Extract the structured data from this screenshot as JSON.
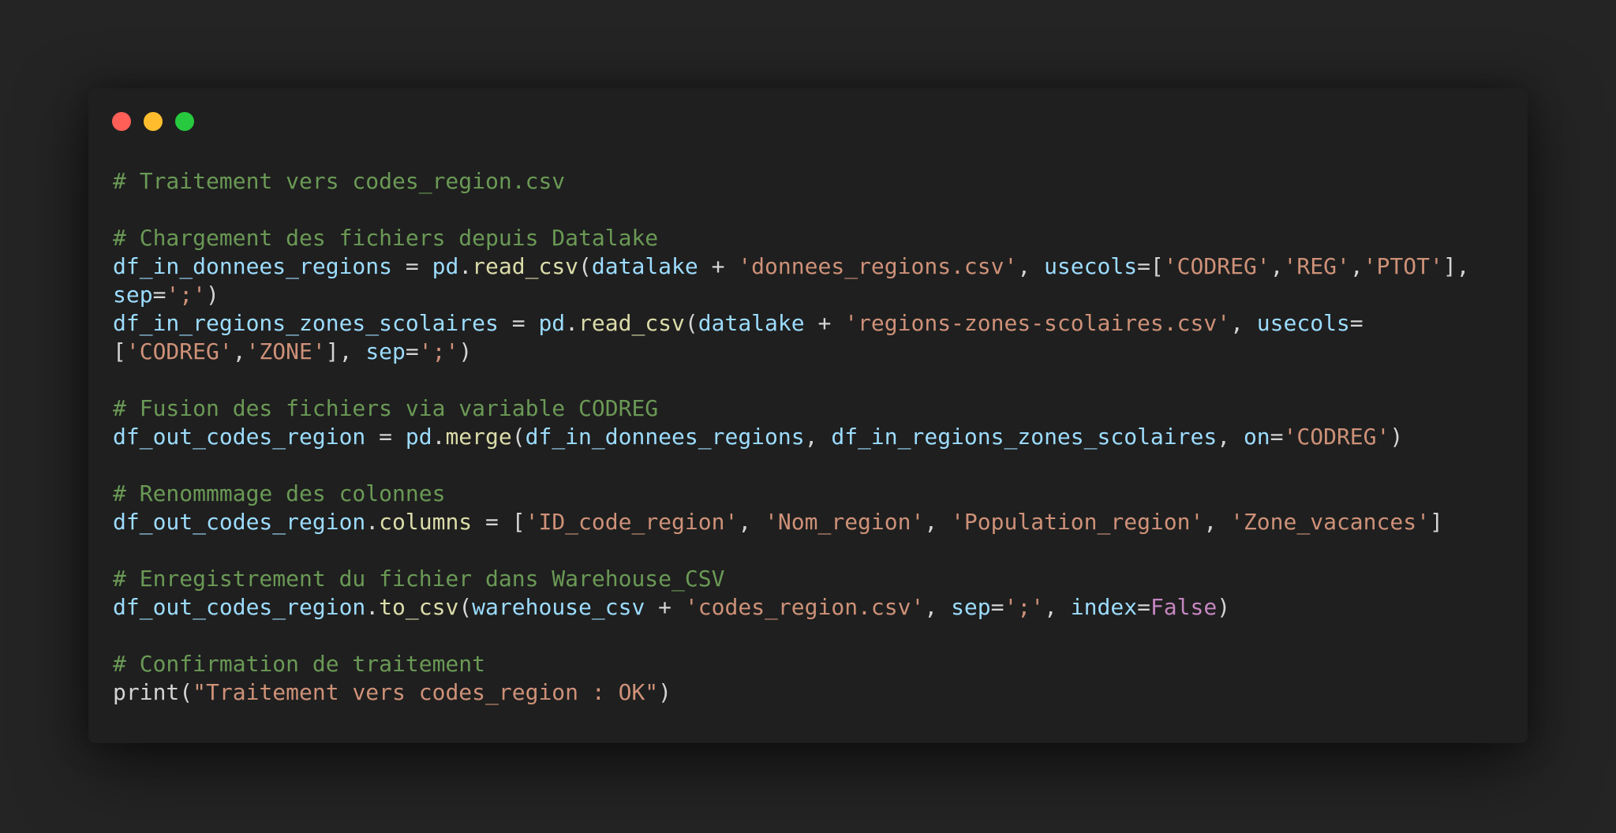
{
  "colors": {
    "background": "#242424",
    "window": "#1f1f1f",
    "dot_close": "#ff5f56",
    "dot_minimize": "#ffbd2e",
    "dot_maximize": "#27c93f",
    "comment": "#6a9955",
    "variable": "#9cdcfe",
    "function": "#dcdcaa",
    "string": "#ce9178",
    "keyword": "#c586c0",
    "plain": "#d4d4d4"
  },
  "window_controls": [
    {
      "name": "close-dot"
    },
    {
      "name": "minimize-dot"
    },
    {
      "name": "maximize-dot"
    }
  ],
  "code_lines": [
    [
      {
        "t": "comment",
        "v": "# Traitement vers codes_region.csv"
      }
    ],
    [],
    [
      {
        "t": "comment",
        "v": "# Chargement des fichiers depuis Datalake"
      }
    ],
    [
      {
        "t": "var",
        "v": "df_in_donnees_regions"
      },
      {
        "t": "plain",
        "v": " = "
      },
      {
        "t": "var",
        "v": "pd"
      },
      {
        "t": "plain",
        "v": "."
      },
      {
        "t": "func",
        "v": "read_csv"
      },
      {
        "t": "plain",
        "v": "("
      },
      {
        "t": "var",
        "v": "datalake"
      },
      {
        "t": "plain",
        "v": " + "
      },
      {
        "t": "string",
        "v": "'donnees_regions.csv'"
      },
      {
        "t": "plain",
        "v": ", "
      },
      {
        "t": "var",
        "v": "usecols"
      },
      {
        "t": "plain",
        "v": "=["
      },
      {
        "t": "string",
        "v": "'CODREG'"
      },
      {
        "t": "plain",
        "v": ","
      },
      {
        "t": "string",
        "v": "'REG'"
      },
      {
        "t": "plain",
        "v": ","
      },
      {
        "t": "string",
        "v": "'PTOT'"
      },
      {
        "t": "plain",
        "v": "],"
      }
    ],
    [
      {
        "t": "var",
        "v": "sep"
      },
      {
        "t": "plain",
        "v": "="
      },
      {
        "t": "string",
        "v": "';'"
      },
      {
        "t": "plain",
        "v": ")"
      }
    ],
    [
      {
        "t": "var",
        "v": "df_in_regions_zones_scolaires"
      },
      {
        "t": "plain",
        "v": " = "
      },
      {
        "t": "var",
        "v": "pd"
      },
      {
        "t": "plain",
        "v": "."
      },
      {
        "t": "func",
        "v": "read_csv"
      },
      {
        "t": "plain",
        "v": "("
      },
      {
        "t": "var",
        "v": "datalake"
      },
      {
        "t": "plain",
        "v": " + "
      },
      {
        "t": "string",
        "v": "'regions-zones-scolaires.csv'"
      },
      {
        "t": "plain",
        "v": ", "
      },
      {
        "t": "var",
        "v": "usecols"
      },
      {
        "t": "plain",
        "v": "="
      }
    ],
    [
      {
        "t": "plain",
        "v": "["
      },
      {
        "t": "string",
        "v": "'CODREG'"
      },
      {
        "t": "plain",
        "v": ","
      },
      {
        "t": "string",
        "v": "'ZONE'"
      },
      {
        "t": "plain",
        "v": "], "
      },
      {
        "t": "var",
        "v": "sep"
      },
      {
        "t": "plain",
        "v": "="
      },
      {
        "t": "string",
        "v": "';'"
      },
      {
        "t": "plain",
        "v": ")"
      }
    ],
    [],
    [
      {
        "t": "comment",
        "v": "# Fusion des fichiers via variable CODREG"
      }
    ],
    [
      {
        "t": "var",
        "v": "df_out_codes_region"
      },
      {
        "t": "plain",
        "v": " = "
      },
      {
        "t": "var",
        "v": "pd"
      },
      {
        "t": "plain",
        "v": "."
      },
      {
        "t": "func",
        "v": "merge"
      },
      {
        "t": "plain",
        "v": "("
      },
      {
        "t": "var",
        "v": "df_in_donnees_regions"
      },
      {
        "t": "plain",
        "v": ", "
      },
      {
        "t": "var",
        "v": "df_in_regions_zones_scolaires"
      },
      {
        "t": "plain",
        "v": ", "
      },
      {
        "t": "var",
        "v": "on"
      },
      {
        "t": "plain",
        "v": "="
      },
      {
        "t": "string",
        "v": "'CODREG'"
      },
      {
        "t": "plain",
        "v": ")"
      }
    ],
    [],
    [
      {
        "t": "comment",
        "v": "# Renommmage des colonnes"
      }
    ],
    [
      {
        "t": "var",
        "v": "df_out_codes_region"
      },
      {
        "t": "plain",
        "v": "."
      },
      {
        "t": "func",
        "v": "columns"
      },
      {
        "t": "plain",
        "v": " = ["
      },
      {
        "t": "string",
        "v": "'ID_code_region'"
      },
      {
        "t": "plain",
        "v": ", "
      },
      {
        "t": "string",
        "v": "'Nom_region'"
      },
      {
        "t": "plain",
        "v": ", "
      },
      {
        "t": "string",
        "v": "'Population_region'"
      },
      {
        "t": "plain",
        "v": ", "
      },
      {
        "t": "string",
        "v": "'Zone_vacances'"
      },
      {
        "t": "plain",
        "v": "]"
      }
    ],
    [],
    [
      {
        "t": "comment",
        "v": "# Enregistrement du fichier dans Warehouse_CSV"
      }
    ],
    [
      {
        "t": "var",
        "v": "df_out_codes_region"
      },
      {
        "t": "plain",
        "v": "."
      },
      {
        "t": "func",
        "v": "to_csv"
      },
      {
        "t": "plain",
        "v": "("
      },
      {
        "t": "var",
        "v": "warehouse_csv"
      },
      {
        "t": "plain",
        "v": " + "
      },
      {
        "t": "string",
        "v": "'codes_region.csv'"
      },
      {
        "t": "plain",
        "v": ", "
      },
      {
        "t": "var",
        "v": "sep"
      },
      {
        "t": "plain",
        "v": "="
      },
      {
        "t": "string",
        "v": "';'"
      },
      {
        "t": "plain",
        "v": ", "
      },
      {
        "t": "var",
        "v": "index"
      },
      {
        "t": "plain",
        "v": "="
      },
      {
        "t": "keyword",
        "v": "False"
      },
      {
        "t": "plain",
        "v": ")"
      }
    ],
    [],
    [
      {
        "t": "comment",
        "v": "# Confirmation de traitement"
      }
    ],
    [
      {
        "t": "plain",
        "v": "print("
      },
      {
        "t": "string",
        "v": "\"Traitement vers codes_region : OK\""
      },
      {
        "t": "plain",
        "v": ")"
      }
    ]
  ]
}
